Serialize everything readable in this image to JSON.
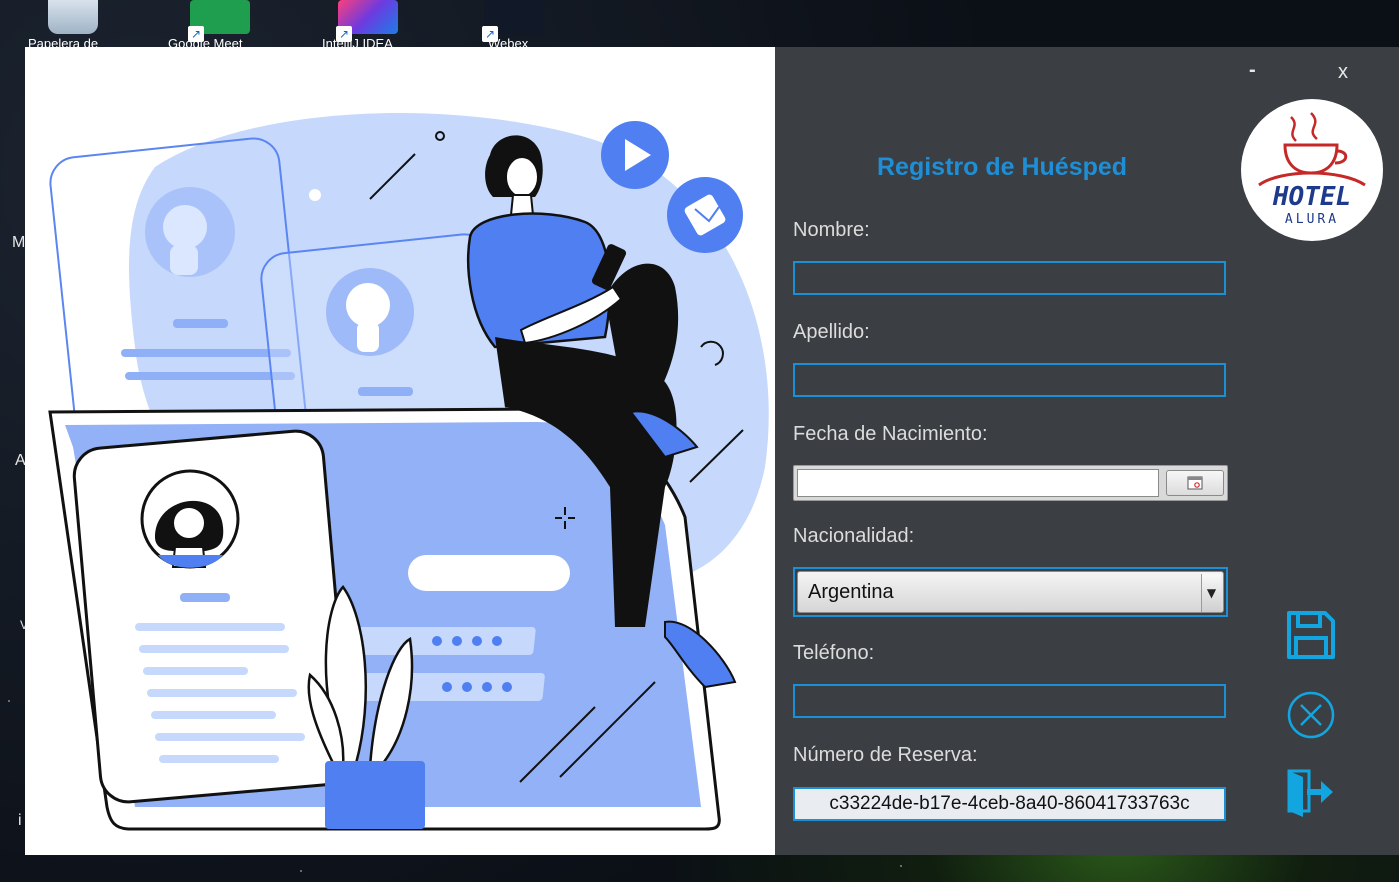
{
  "desktop": {
    "icons": [
      {
        "label": "Papelera de",
        "name": "recycle-bin-icon"
      },
      {
        "label": "Google Meet",
        "name": "google-meet-icon"
      },
      {
        "label": "IntelliJ IDEA",
        "name": "intellij-icon"
      },
      {
        "label": "Webex",
        "name": "webex-icon"
      }
    ],
    "edge_letters": [
      "M",
      "A",
      "V",
      "i"
    ]
  },
  "window": {
    "minimize_label": "-",
    "close_label": "x",
    "logo": {
      "text": "HOTEL",
      "subtext": "ALURA"
    }
  },
  "form": {
    "title": "Registro de Huésped",
    "nombre": {
      "label": "Nombre:",
      "value": ""
    },
    "apellido": {
      "label": "Apellido:",
      "value": ""
    },
    "fecha_nacimiento": {
      "label": "Fecha de Nacimiento:",
      "value": ""
    },
    "nacionalidad": {
      "label": "Nacionalidad:",
      "value": "Argentina"
    },
    "telefono": {
      "label": "Teléfono:",
      "value": ""
    },
    "numero_reserva": {
      "label": "Número de Reserva:",
      "value": "c33224de-b17e-4ceb-8a40-86041733763c"
    }
  },
  "colors": {
    "panel_bg": "#3b3e42",
    "accent": "#1e8fd6",
    "illustration_primary": "#4f7ff0",
    "illustration_light": "#c6d8fb"
  }
}
